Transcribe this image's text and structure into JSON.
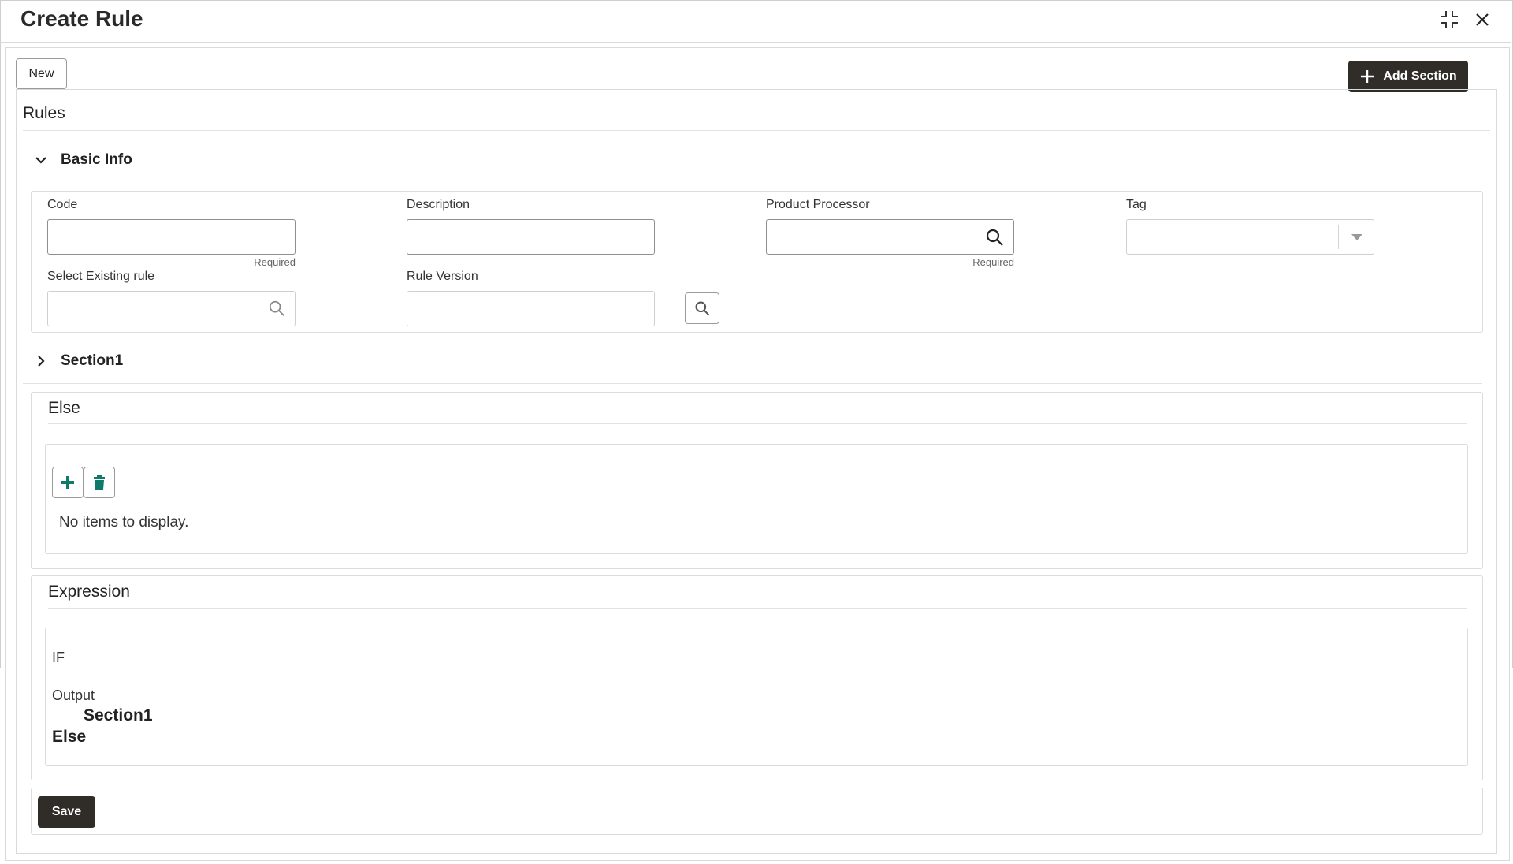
{
  "window": {
    "title": "Create Rule"
  },
  "toolbar": {
    "new_label": "New",
    "add_section_label": "Add Section"
  },
  "rules": {
    "title": "Rules"
  },
  "basic_info": {
    "title": "Basic Info",
    "code": {
      "label": "Code",
      "value": "",
      "hint": "Required"
    },
    "description": {
      "label": "Description",
      "value": ""
    },
    "product_processor": {
      "label": "Product Processor",
      "value": "",
      "hint": "Required"
    },
    "tag": {
      "label": "Tag",
      "value": ""
    },
    "select_existing_rule": {
      "label": "Select Existing rule",
      "value": ""
    },
    "rule_version": {
      "label": "Rule Version",
      "value": ""
    }
  },
  "section1": {
    "title": "Section1"
  },
  "else_panel": {
    "title": "Else",
    "empty_text": "No items to display."
  },
  "expression": {
    "title": "Expression",
    "if_label": "IF",
    "output_label": "Output",
    "section_item": "Section1",
    "else_item": "Else"
  },
  "footer": {
    "save_label": "Save"
  },
  "colors": {
    "dark_button": "#302c28",
    "icon_teal": "#0d7a6a"
  }
}
